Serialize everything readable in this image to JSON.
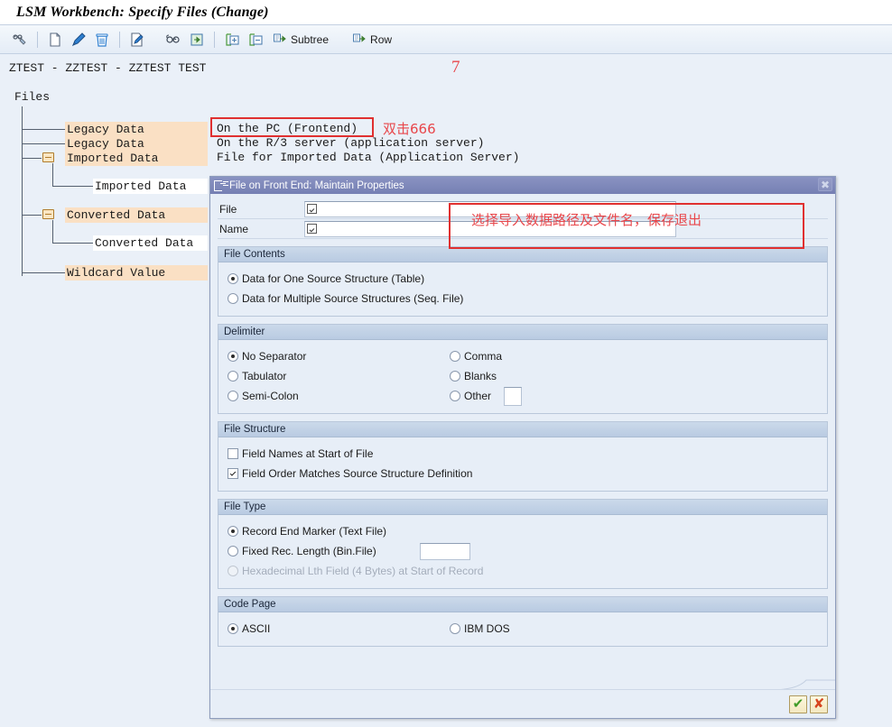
{
  "window": {
    "title": "LSM Workbench: Specify Files (Change)"
  },
  "toolbar": {
    "items": [
      {
        "name": "display-change-icon",
        "label": ""
      },
      {
        "name": "new-document-icon",
        "label": ""
      },
      {
        "name": "edit-pencil-icon",
        "label": ""
      },
      {
        "name": "delete-trash-icon",
        "label": ""
      },
      {
        "name": "edit-document-icon",
        "label": ""
      },
      {
        "name": "display-glasses-icon",
        "label": ""
      },
      {
        "name": "export-arrow-icon",
        "label": ""
      },
      {
        "name": "expand-subtree-icon",
        "label": ""
      },
      {
        "name": "collapse-subtree-icon",
        "label": ""
      }
    ],
    "subtree_label": "Subtree",
    "row_label": "Row"
  },
  "breadcrumb": {
    "text": "ZTEST - ZZTEST - ZZTEST TEST"
  },
  "annotations": {
    "step_marker": "7",
    "tree_note": "双击666",
    "dialog_note": "选择导入数据路径及文件名，保存退出"
  },
  "tree": {
    "root_label": "Files",
    "nodes": [
      {
        "label": "Legacy Data",
        "description": "On the PC (Frontend)",
        "folder": false,
        "selected": true,
        "highlighted": true
      },
      {
        "label": "Legacy Data",
        "description": "On the R/3 server (application server)",
        "folder": false,
        "selected": false,
        "highlighted": true
      },
      {
        "label": "Imported Data",
        "description": "File for Imported Data (Application Server)",
        "folder": true,
        "selected": false,
        "highlighted": true
      },
      {
        "label": "Imported Data",
        "description": "",
        "folder": false,
        "selected": false,
        "highlighted": false
      },
      {
        "label": "Converted Data",
        "description": "",
        "folder": true,
        "selected": false,
        "highlighted": true
      },
      {
        "label": "Converted Data",
        "description": "",
        "folder": false,
        "selected": false,
        "highlighted": false
      },
      {
        "label": "Wildcard Value",
        "description": "",
        "folder": false,
        "selected": false,
        "highlighted": true
      }
    ]
  },
  "dialog": {
    "title": "File on Front End: Maintain Properties",
    "close_label": "✖",
    "fields": [
      {
        "label": "File",
        "value": "",
        "placeholder": ""
      },
      {
        "label": "Name",
        "value": "",
        "placeholder": ""
      }
    ],
    "groups": {
      "file_contents": {
        "title": "File Contents",
        "options": [
          {
            "label": "Data for One Source Structure (Table)",
            "selected": true
          },
          {
            "label": "Data for Multiple Source Structures (Seq. File)",
            "selected": false
          }
        ]
      },
      "delimiter": {
        "title": "Delimiter",
        "left_options": [
          {
            "label": "No Separator",
            "selected": true
          },
          {
            "label": "Tabulator",
            "selected": false
          },
          {
            "label": "Semi-Colon",
            "selected": false
          }
        ],
        "right_options": [
          {
            "label": "Comma",
            "selected": false
          },
          {
            "label": "Blanks",
            "selected": false
          },
          {
            "label": "Other",
            "selected": false
          }
        ],
        "other_value": ""
      },
      "file_structure": {
        "title": "File Structure",
        "checkboxes": [
          {
            "label": "Field Names at Start of File",
            "checked": false
          },
          {
            "label": "Field Order Matches Source Structure Definition",
            "checked": true
          }
        ]
      },
      "file_type": {
        "title": "File Type",
        "options": [
          {
            "label": "Record End Marker (Text File)",
            "selected": true,
            "disabled": false
          },
          {
            "label": "Fixed Rec. Length (Bin.File)",
            "selected": false,
            "disabled": false
          },
          {
            "label": "Hexadecimal Lth Field (4 Bytes) at Start of Record",
            "selected": false,
            "disabled": true
          }
        ],
        "length_value": ""
      },
      "code_page": {
        "title": "Code Page",
        "left_options": [
          {
            "label": "ASCII",
            "selected": true
          }
        ],
        "right_options": [
          {
            "label": "IBM DOS",
            "selected": false
          }
        ]
      }
    },
    "footer": {
      "ok_label": "✔",
      "cancel_label": "✘"
    }
  },
  "colors": {
    "page_background": "#eaf0f8",
    "dialog_titlebar": "#757fb3",
    "group_header": "#c2d2e6",
    "tree_highlight": "#fae0c4",
    "annotation_red": "#e8464a",
    "box_red": "#e03030"
  }
}
